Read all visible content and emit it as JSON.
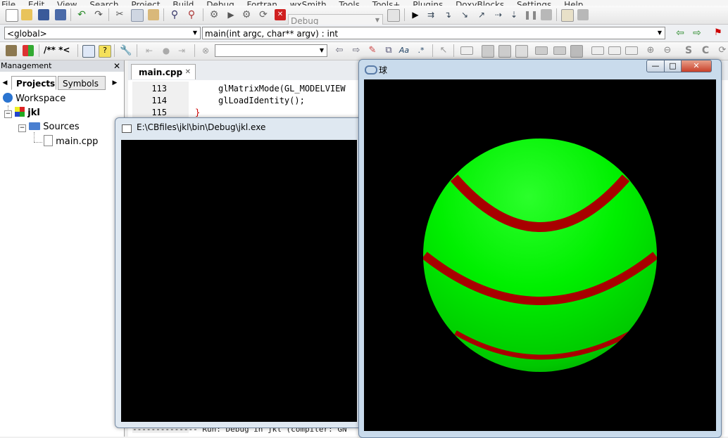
{
  "menubar": [
    "File",
    "Edit",
    "View",
    "Search",
    "Project",
    "Build",
    "Debug",
    "Fortran",
    "wxSmith",
    "Tools",
    "Tools+",
    "Plugins",
    "DoxyBlocks",
    "Settings",
    "Help"
  ],
  "toolbar": {
    "build_target": "Debug",
    "scope": "<global>",
    "function": "main(int argc, char** argv) : int",
    "doxy_comment": "/** *<",
    "search_value": ""
  },
  "management": {
    "title": "Management",
    "close": "✕",
    "tabs": [
      "Projects",
      "Symbols"
    ],
    "tree": {
      "workspace": "Workspace",
      "project": "jkl",
      "folder": "Sources",
      "file": "main.cpp"
    }
  },
  "editor": {
    "tab": "main.cpp",
    "tab_close": "✕",
    "lines": [
      {
        "num": "113",
        "text": "glMatrixMode(GL_MODELVIEW"
      },
      {
        "num": "114",
        "text": "glLoadIdentity();"
      },
      {
        "num": "115",
        "text": "}"
      }
    ]
  },
  "console": {
    "title": "E:\\CBfiles\\jkl\\bin\\Debug\\jkl.exe"
  },
  "glwindow": {
    "title": "球",
    "buttons": {
      "minimize": "—",
      "maximize": "□",
      "close": "✕"
    }
  },
  "log": {
    "line": "-------------- Run: Debug in jkl (compiler: GN"
  },
  "colors": {
    "sphere": "#00f000",
    "stripe": "#a80000",
    "background": "#000000"
  }
}
